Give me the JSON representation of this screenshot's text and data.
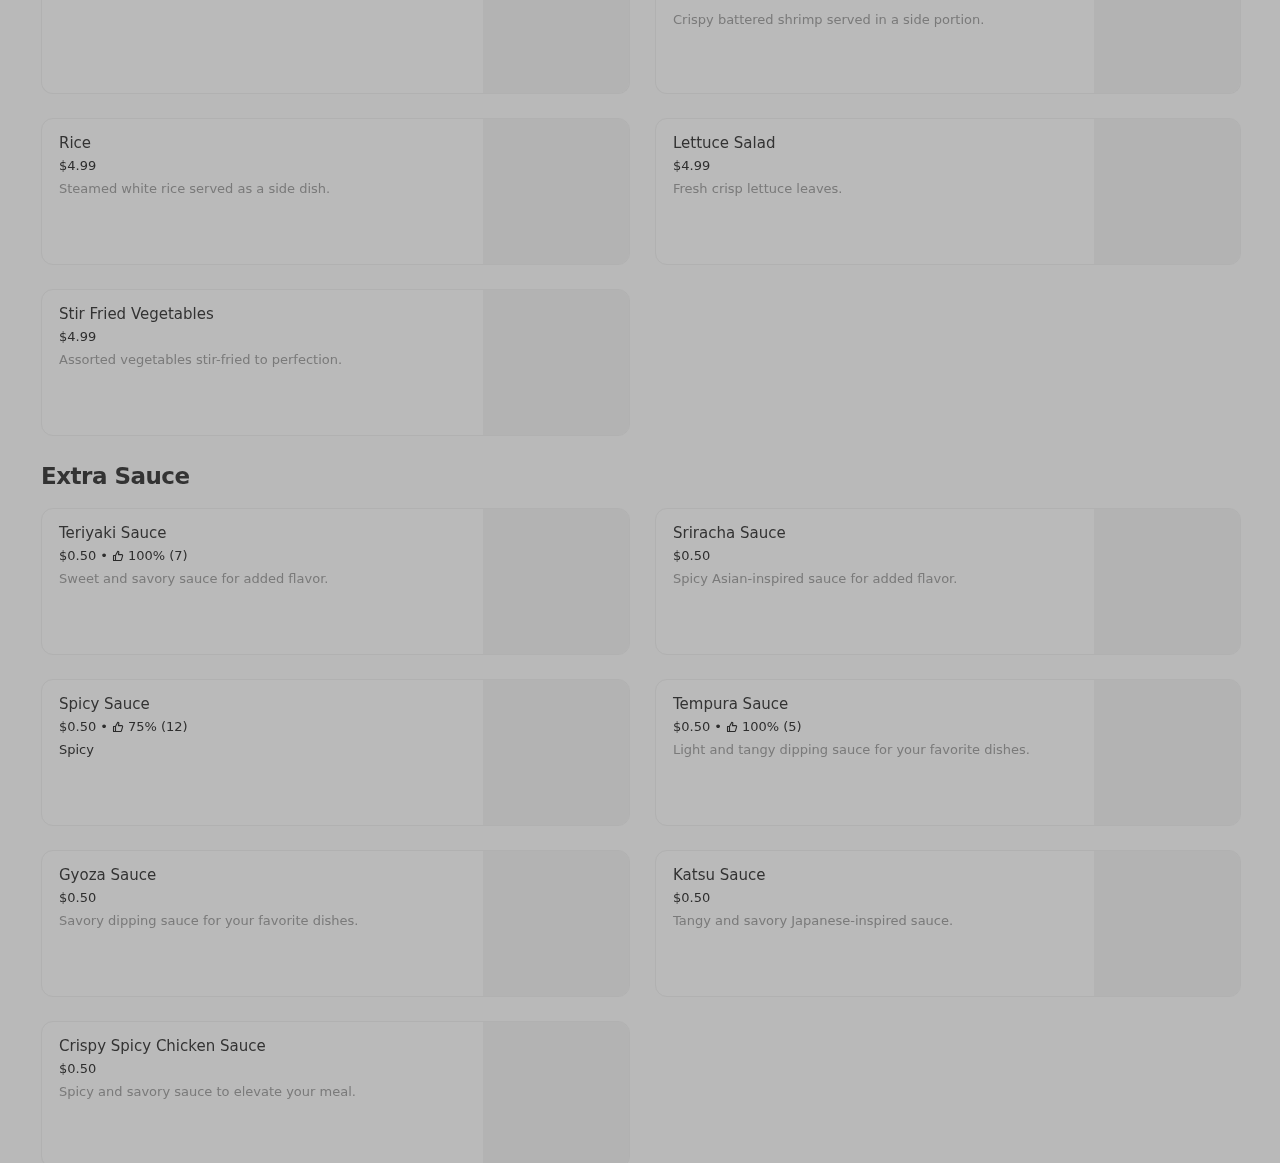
{
  "top_row": [
    {
      "clipped": true
    },
    {
      "clipped": true,
      "description": "Crispy battered shrimp served in a side portion."
    }
  ],
  "sections": [
    {
      "items": [
        {
          "name": "Rice",
          "price": "$4.99",
          "description": "Steamed white rice served as a side dish."
        },
        {
          "name": "Lettuce Salad",
          "price": "$4.99",
          "description": "Fresh crisp lettuce leaves."
        },
        {
          "name": "Stir Fried Vegetables",
          "price": "$4.99",
          "description": "Assorted vegetables stir-fried to perfection."
        }
      ]
    },
    {
      "title": "Extra Sauce",
      "items": [
        {
          "name": "Teriyaki Sauce",
          "price": "$0.50",
          "separator": "•",
          "rating": "100% (7)",
          "description": "Sweet and savory sauce for added flavor."
        },
        {
          "name": "Sriracha Sauce",
          "price": "$0.50",
          "description": "Spicy Asian-inspired sauce for added flavor."
        },
        {
          "name": "Spicy Sauce",
          "price": "$0.50",
          "separator": "•",
          "rating": "75% (12)",
          "description": "Spicy",
          "emphasis": true
        },
        {
          "name": "Tempura Sauce",
          "price": "$0.50",
          "separator": "•",
          "rating": "100% (5)",
          "description": "Light and tangy dipping sauce for your favorite dishes."
        },
        {
          "name": "Gyoza Sauce",
          "price": "$0.50",
          "description": "Savory dipping sauce for your favorite dishes."
        },
        {
          "name": "Katsu Sauce",
          "price": "$0.50",
          "description": "Tangy and savory Japanese-inspired sauce."
        },
        {
          "name": "Crispy Spicy Chicken Sauce",
          "price": "$0.50",
          "description": "Spicy and savory sauce to elevate your meal."
        }
      ]
    }
  ]
}
